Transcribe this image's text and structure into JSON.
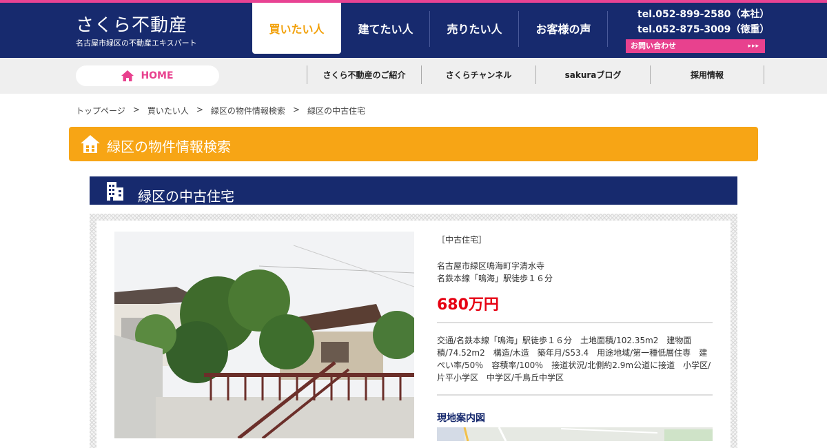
{
  "header": {
    "logo_title": "さくら不動産",
    "logo_subtitle": "名古屋市緑区の不動産エキスパート",
    "nav": [
      {
        "label": "買いたい人",
        "active": true
      },
      {
        "label": "建てたい人",
        "active": false
      },
      {
        "label": "売りたい人",
        "active": false
      },
      {
        "label": "お客様の声",
        "active": false
      }
    ],
    "tel_main": "tel.052-899-2580（本社）",
    "tel_branch": "tel.052-875-3009（徳重）",
    "contact_label": "お問い合わせ",
    "contact_arrows": "▸▸▸"
  },
  "subnav": {
    "home_label": "HOME",
    "items": [
      "さくら不動産のご紹介",
      "さくらチャンネル",
      "sakuraブログ",
      "採用情報"
    ]
  },
  "breadcrumb": {
    "items": [
      "トップページ",
      "買いたい人",
      "緑区の物件情報検索",
      "緑区の中古住宅"
    ],
    "separator": ">"
  },
  "section": {
    "title": "緑区の物件情報検索"
  },
  "listing": {
    "category_title": "緑区の中古住宅",
    "type": "［中古住宅］",
    "address": "名古屋市緑区鳴海町字清水寺",
    "access": "名鉄本線「鳴海」駅徒歩１６分",
    "price": "680万円",
    "description": "交通/名鉄本線「鳴海」駅徒歩１６分　土地面積/102.35m2　建物面積/74.52m2　構造/木造　築年月/S53.4　用途地域/第一種低層住専　建ぺい率/50％　容積率/100％　接道状況/北側約2.9m公道に接道　小学区/片平小学区　中学区/千鳥丘中学区",
    "map_heading": "現地案内図"
  },
  "colors": {
    "navy": "#172a6e",
    "pink": "#e8418e",
    "orange": "#f7a515",
    "price_red": "#e60012"
  }
}
